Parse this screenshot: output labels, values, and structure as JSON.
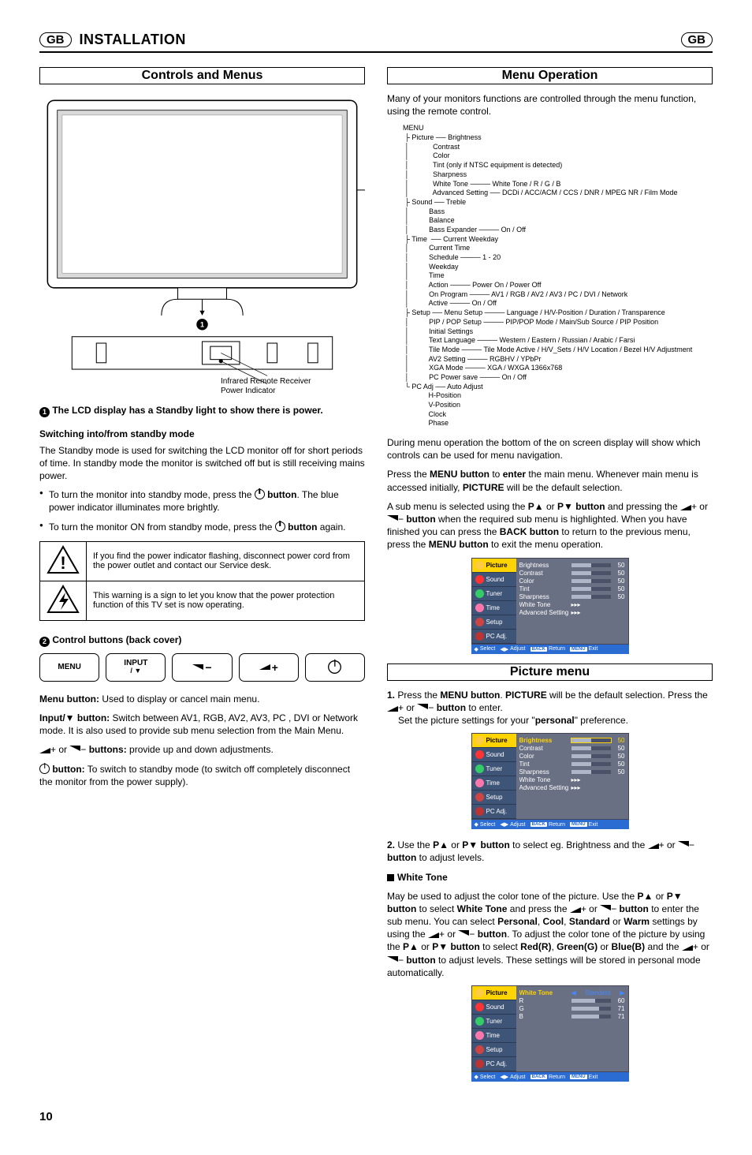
{
  "header": {
    "gb": "GB",
    "title": "INSTALLATION"
  },
  "left": {
    "sec1_title": "Controls and Menus",
    "diag_label_ir": "Infrared Remote Receiver",
    "diag_label_power": "Power Indicator",
    "note1_pre": "The LCD display has a Standby light to show there is power.",
    "sub_standby": "Switching into/from standby mode",
    "standby_para": "The Standby mode is used for switching the LCD monitor off for short periods of time. In standby mode the monitor is switched off but is still receiving mains power.",
    "b1a": "To turn the monitor into standby mode, press the ",
    "b1b": " button",
    "b1c": ". The blue power indicator illuminates more brightly.",
    "b2a": "To turn the monitor ON from standby mode, press the ",
    "b2b": " button",
    "b2c": " again.",
    "warn1": "If you find the power indicator flashing, disconnect power cord from the power outlet and contact our Service desk.",
    "warn2": "This warning is a sign to let you know that the power protection function of this TV set is now operating.",
    "ctrl_back": "Control buttons (back cover)",
    "btn_menu": "MENU",
    "btn_input": "INPUT",
    "btn_input2": "/ ▼",
    "menu_btn_h": "Menu button:",
    "menu_btn_t": " Used to display or cancel main menu.",
    "input_btn_h": "Input/▼ button:",
    "input_btn_t": " Switch between AV1, RGB, AV2, AV3, PC , DVI or Network mode. It is also used to provide sub menu selection from the Main Menu.",
    "vol_btns_t": " provide up and down adjustments.",
    "vol_btns_h": "buttons:",
    "pwr_btn_h": "button:",
    "pwr_btn_t": " To switch to standby mode (to switch off completely disconnect the monitor from the power supply)."
  },
  "right": {
    "sec_menu_title": "Menu Operation",
    "intro": "Many of your monitors functions are controlled through the menu function, using the remote control.",
    "tree": "MENU\n ├ Picture ── Brightness\n │            Contrast\n │            Color\n │            Tint (only if NTSC equipment is detected)\n │            Sharpness\n │            White Tone ──── White Tone / R / G / B\n │            Advanced Setting ── DCDi / ACC/ACM / CCS / DNR / MPEG NR / Film Mode\n ├ Sound ── Treble\n │          Bass\n │          Balance\n │          Bass Expander ──── On / Off\n ├ Time  ── Current Weekday\n │          Current Time\n │          Schedule ──── 1 - 20\n │          Weekday\n │          Time\n │          Action ──── Power On / Power Off\n │          On Program ──── AV1 / RGB / AV2 / AV3 / PC / DVI / Network\n │          Active ──── On / Off\n ├ Setup ── Menu Setup ──── Language / H/V-Position / Duration / Transparence\n │          PIP / POP Setup ──── PIP/POP Mode / Main/Sub Source / PIP Position\n │          Initial Settings\n │          Text Language ──── Western / Eastern / Russian / Arabic / Farsi\n │          Tile Mode ──── Tile Mode Active / H/V_Sets / H/V Location / Bezel H/V Adjustment\n │          AV2 Setting ──── RGBHV / YPbPr\n │          XGA Mode ──── XGA / WXGA 1366x768\n │          PC Power save ──── On / Off\n └ PC Adj ── Auto Adjust\n             H-Position\n             V-Position\n             Clock\n             Phase",
    "para2": "During menu operation the bottom of the on screen display will show which controls can be used for menu navigation.",
    "para3a": "Press the ",
    "para3b": "MENU button",
    "para3c": " to ",
    "para3d": "enter",
    "para3e": " the main menu. Whenever main menu is accessed initially, ",
    "para3f": "PICTURE",
    "para3g": " will be the default selection.",
    "para4a": "A sub menu is selected using the ",
    "para4b": " or ",
    "para4c": " button",
    "para4d": " and pressing the ",
    "para4e": " button",
    "para4f": " when the required sub menu is highlighted. When you have finished you can press the ",
    "para4g": "BACK button",
    "para4h": " to return to the previous menu, press the ",
    "para4i": "MENU button",
    "para4j": " to exit the menu operation.",
    "sec_pic_title": "Picture menu",
    "step1a": "Press the ",
    "step1b": "MENU button",
    "step1c": ". ",
    "step1d": "PICTURE",
    "step1e": " will be the default selection. Press the ",
    "step1f": " button",
    "step1g": " to enter.",
    "step1h": "Set the picture settings for your \"",
    "step1i": "personal",
    "step1j": "\" preference.",
    "step2a": "Use the ",
    "step2b": " or ",
    "step2c": " button",
    "step2d": " to select eg. Brightness and the ",
    "step2e": " button",
    "step2f": " to adjust levels.",
    "wt_h": "White Tone",
    "wt_p1a": "May be used to adjust the color tone of the picture. Use the ",
    "wt_p1b": " or ",
    "wt_p1c": " button",
    "wt_p1d": " to select ",
    "wt_p1e": "White Tone",
    "wt_p1f": " and press the ",
    "wt_p1g": " button",
    "wt_p1h": " to enter the sub menu. You can select ",
    "wt_p1i": "Personal",
    "wt_p1j": ", ",
    "wt_p1k": "Cool",
    "wt_p1l": ", ",
    "wt_p1m": "Standard",
    "wt_p1n": " or ",
    "wt_p1o": "Warm",
    "wt_p1p": " settings by using the ",
    "wt_p1q": " button",
    "wt_p1r": ". To adjust the color tone of the picture by using the ",
    "wt_p1s": " button",
    "wt_p1t": " to select ",
    "wt_p1u": "Red(R)",
    "wt_p1v": ", ",
    "wt_p1w": "Green(G)",
    "wt_p1x": " or ",
    "wt_p1y": "Blue(B)",
    "wt_p1z": " and the ",
    "wt_p2a": " button",
    "wt_p2b": " to adjust levels. These settings will be stored in personal mode automatically."
  },
  "osd": {
    "tabs": [
      "Picture",
      "Sound",
      "Tuner",
      "Time",
      "Setup",
      "PC Adj."
    ],
    "rows": [
      {
        "lbl": "Brightness",
        "val": "50"
      },
      {
        "lbl": "Contrast",
        "val": "50"
      },
      {
        "lbl": "Color",
        "val": "50"
      },
      {
        "lbl": "Tint",
        "val": "50"
      },
      {
        "lbl": "Sharpness",
        "val": "50"
      },
      {
        "lbl": "White Tone",
        "val": "▸▸▸"
      },
      {
        "lbl": "Advanced Settings",
        "val": "▸▸▸"
      }
    ],
    "foot": {
      "select": "Select",
      "adjust": "Adjust",
      "back": "BACK",
      "ret": "Return",
      "menu": "MENU",
      "exit": "Exit"
    }
  },
  "osd3": {
    "header": "White Tone",
    "mode": "Standard",
    "rows": [
      {
        "lbl": "R",
        "val": "60"
      },
      {
        "lbl": "G",
        "val": "71"
      },
      {
        "lbl": "B",
        "val": "71"
      }
    ]
  },
  "page": "10"
}
